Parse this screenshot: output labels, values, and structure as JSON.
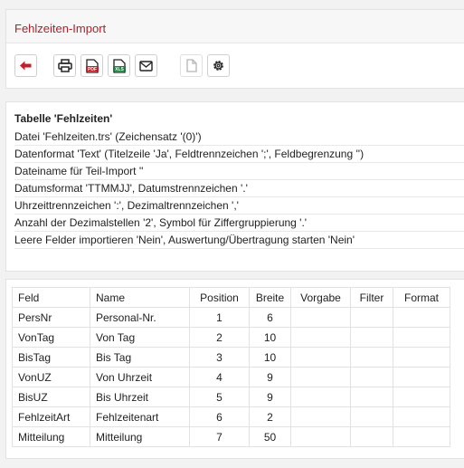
{
  "header": {
    "title": "Fehlzeiten-Import"
  },
  "toolbar": {
    "buttons": [
      {
        "icon": "back-arrow-icon",
        "color": "#c0202a"
      },
      {
        "icon": "print-icon"
      },
      {
        "icon": "pdf-icon",
        "badge": "PDF",
        "color": "#c0202a"
      },
      {
        "icon": "xls-icon",
        "badge": "XLS",
        "color": "#1e7a3c"
      },
      {
        "icon": "mail-icon"
      },
      {
        "icon": "document-icon",
        "disabled": true
      },
      {
        "icon": "settings-icon"
      }
    ]
  },
  "info": {
    "title": "Tabelle 'Fehlzeiten'",
    "lines": [
      "Datei 'Fehlzeiten.trs' (Zeichensatz '(0)')",
      "Datenformat 'Text' (Titelzeile 'Ja', Feldtrennzeichen ';', Feldbegrenzung '')",
      "Dateiname für Teil-Import ''",
      "Datumsformat 'TTMMJJ', Datumstrennzeichen '.'",
      "Uhrzeittrennzeichen ':', Dezimaltrennzeichen ','",
      "Anzahl der Dezimalstellen '2', Symbol für Ziffergruppierung '.'",
      "Leere Felder importieren 'Nein', Auswertung/Übertragung starten 'Nein'"
    ]
  },
  "table": {
    "columns": [
      "Feld",
      "Name",
      "Position",
      "Breite",
      "Vorgabe",
      "Filter",
      "Format"
    ],
    "rows": [
      [
        "PersNr",
        "Personal-Nr.",
        "1",
        "6",
        "",
        "",
        ""
      ],
      [
        "VonTag",
        "Von Tag",
        "2",
        "10",
        "",
        "",
        ""
      ],
      [
        "BisTag",
        "Bis Tag",
        "3",
        "10",
        "",
        "",
        ""
      ],
      [
        "VonUZ",
        "Von Uhrzeit",
        "4",
        "9",
        "",
        "",
        ""
      ],
      [
        "BisUZ",
        "Bis Uhrzeit",
        "5",
        "9",
        "",
        "",
        ""
      ],
      [
        "FehlzeitArt",
        "Fehlzeitenart",
        "6",
        "2",
        "",
        "",
        ""
      ],
      [
        "Mitteilung",
        "Mitteilung",
        "7",
        "50",
        "",
        "",
        ""
      ]
    ]
  }
}
